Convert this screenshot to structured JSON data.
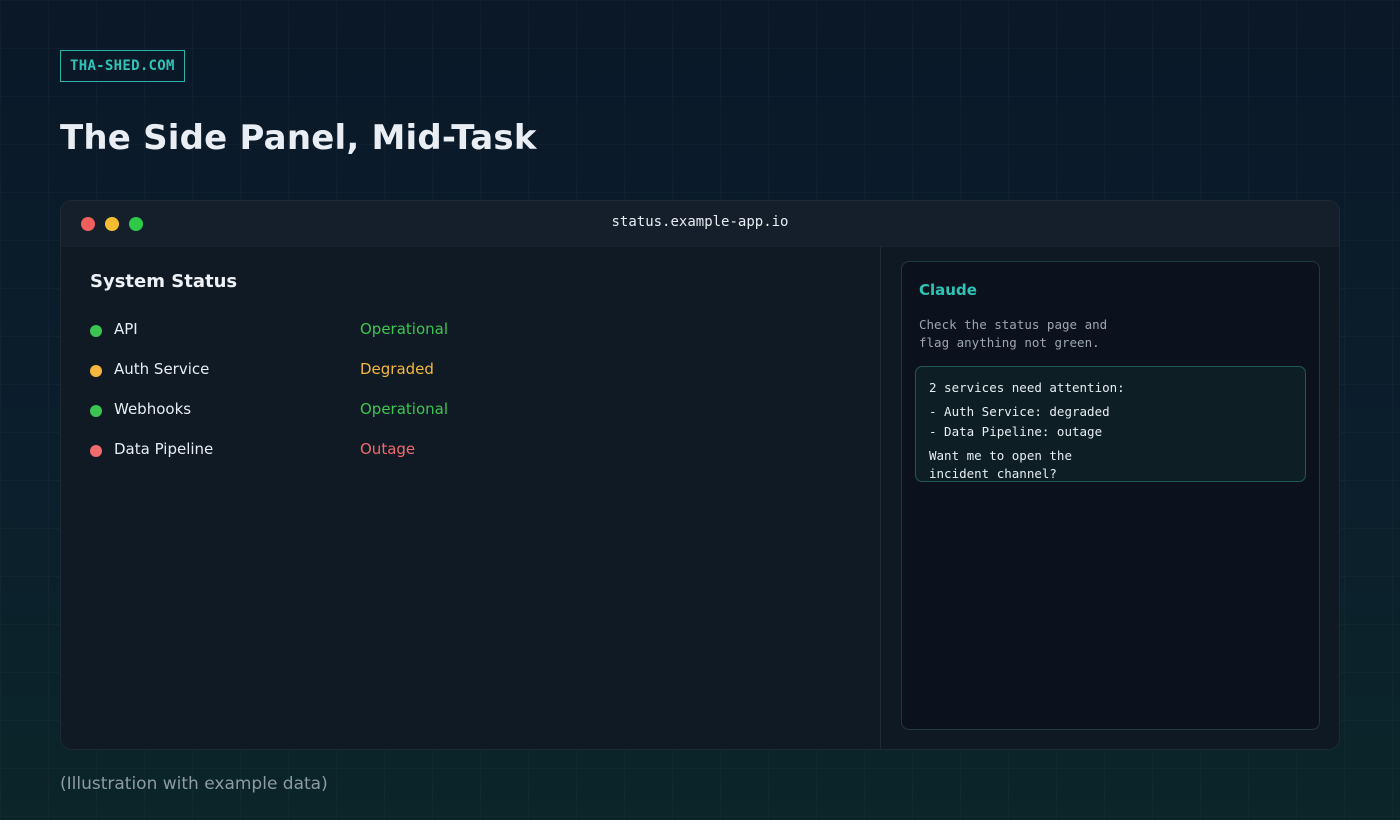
{
  "brand": "THA-SHED.COM",
  "headline": "The Side Panel, Mid-Task",
  "browser": {
    "url": "status.example-app.io"
  },
  "status_page": {
    "heading": "System Status",
    "services": [
      {
        "name": "API",
        "state": "Operational",
        "color": "#3cc651"
      },
      {
        "name": "Auth Service",
        "state": "Degraded",
        "color": "#f5b83d"
      },
      {
        "name": "Webhooks",
        "state": "Operational",
        "color": "#3cc651"
      },
      {
        "name": "Data Pipeline",
        "state": "Outage",
        "color": "#f06b6b"
      }
    ]
  },
  "side_panel": {
    "assistant_name": "Claude",
    "user_message": "Check the status page and\nflag anything not green.",
    "reply": {
      "summary": "2 services need attention:",
      "items": [
        "- Auth Service: degraded",
        "- Data Pipeline: outage"
      ],
      "question": "Want me to open the\nincident channel?"
    }
  },
  "caption": "(Illustration with example data)",
  "colors": {
    "accent": "#2ec4b6",
    "operational": "#3cc651",
    "degraded": "#f5b83d",
    "outage": "#f06b6b"
  }
}
